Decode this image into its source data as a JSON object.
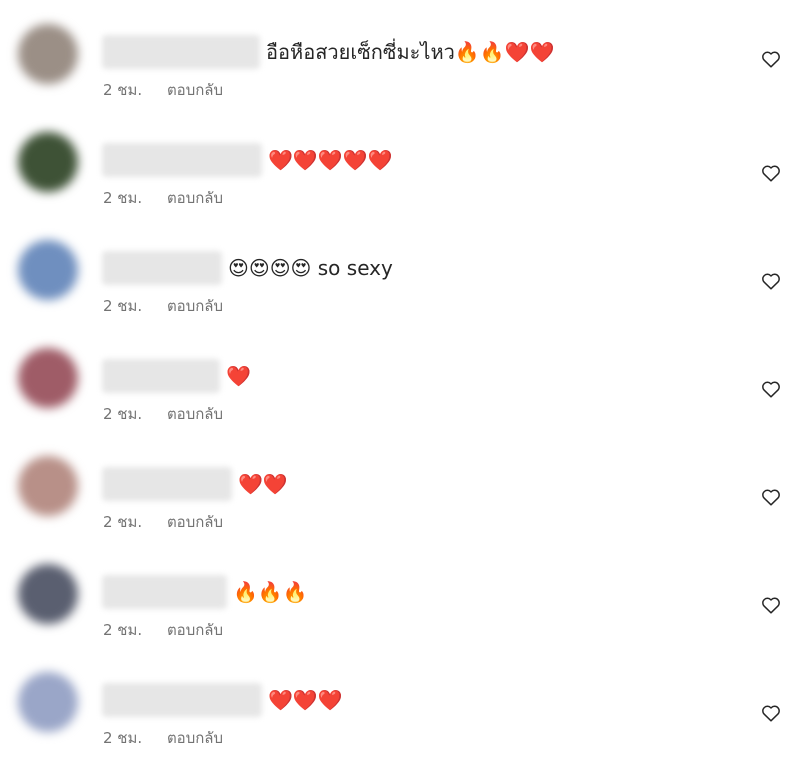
{
  "comments": [
    {
      "avatar_color": "#9b8f86",
      "username_width": 158,
      "text": "อือหือสวยเซ็กซี่มะไหว🔥🔥❤️❤️",
      "time": "2 ชม.",
      "reply": "ตอบกลับ"
    },
    {
      "avatar_color": "#3e5236",
      "username_width": 160,
      "text": "❤️❤️❤️❤️❤️",
      "time": "2 ชม.",
      "reply": "ตอบกลับ"
    },
    {
      "avatar_color": "#6f8fbf",
      "username_width": 120,
      "text": "😍😍😍😍 so sexy",
      "time": "2 ชม.",
      "reply": "ตอบกลับ"
    },
    {
      "avatar_color": "#9f5c67",
      "username_width": 118,
      "text": "❤️",
      "time": "2 ชม.",
      "reply": "ตอบกลับ"
    },
    {
      "avatar_color": "#b89088",
      "username_width": 130,
      "text": "❤️❤️",
      "time": "2 ชม.",
      "reply": "ตอบกลับ"
    },
    {
      "avatar_color": "#5a5f70",
      "username_width": 125,
      "text": "🔥🔥🔥",
      "time": "2 ชม.",
      "reply": "ตอบกลับ"
    },
    {
      "avatar_color": "#9aa6c8",
      "username_width": 160,
      "text": "❤️❤️❤️",
      "time": "2 ชม.",
      "reply": "ตอบกลับ"
    }
  ]
}
